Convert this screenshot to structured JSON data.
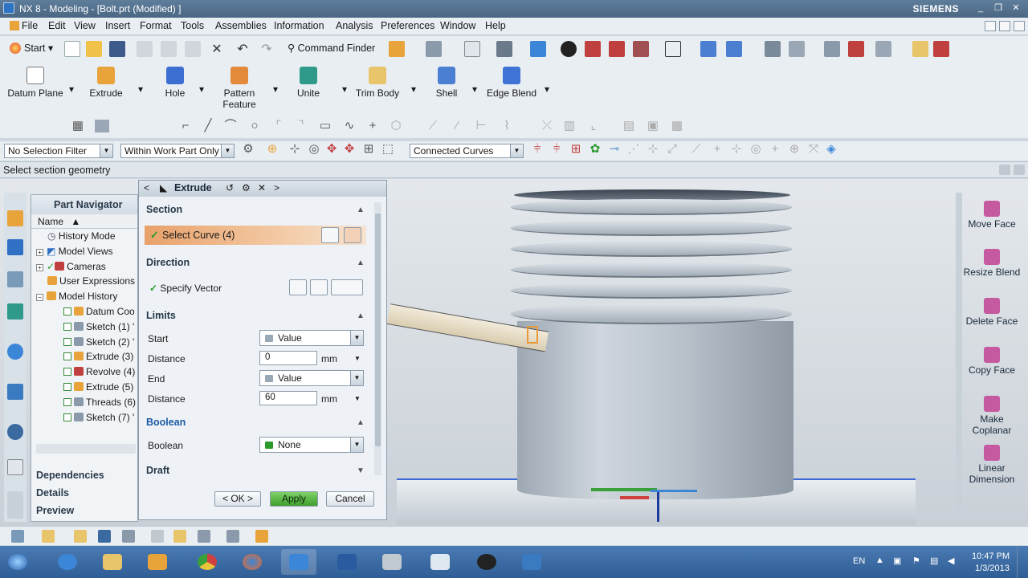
{
  "window": {
    "title": "NX 8 - Modeling - [Bolt.prt (Modified) ]",
    "brand": "SIEMENS"
  },
  "menu": [
    "File",
    "Edit",
    "View",
    "Insert",
    "Format",
    "Tools",
    "Assemblies",
    "Information",
    "Analysis",
    "Preferences",
    "Window",
    "Help"
  ],
  "toolbar": {
    "start_label": "Start",
    "command_finder_label": "Command Finder"
  },
  "ribbon": [
    {
      "label": "Datum Plane",
      "icon": "datum-plane-icon",
      "color": "#ffffff"
    },
    {
      "label": "Extrude",
      "icon": "extrude-icon",
      "color": "#e8a33a"
    },
    {
      "label": "Hole",
      "icon": "hole-icon",
      "color": "#3c6fd1"
    },
    {
      "label": "Pattern",
      "label2": "Feature",
      "icon": "pattern-feature-icon",
      "color": "#e38a3a"
    },
    {
      "label": "Unite",
      "icon": "unite-icon",
      "color": "#2f9a8a"
    },
    {
      "label": "Trim Body",
      "icon": "trim-body-icon",
      "color": "#e8c46a"
    },
    {
      "label": "Shell",
      "icon": "shell-icon",
      "color": "#4a7fd1"
    },
    {
      "label": "Edge Blend",
      "icon": "edge-blend-icon",
      "color": "#3f74d6"
    }
  ],
  "filters": {
    "selection_filter": "No Selection Filter",
    "scope": "Within Work Part Only",
    "curve_rule": "Connected Curves"
  },
  "cue_line": "Select section geometry",
  "part_navigator": {
    "title": "Part Navigator",
    "column": "Name",
    "items": [
      "History Mode",
      "Model Views",
      "Cameras",
      "User Expressions",
      "Model History",
      "Datum Coo",
      "Sketch (1) '",
      "Sketch (2) '",
      "Extrude (3)",
      "Revolve (4)",
      "Extrude (5)",
      "Threads (6)",
      "Sketch (7) '"
    ],
    "panels": [
      "Dependencies",
      "Details",
      "Preview"
    ]
  },
  "extrude_dialog": {
    "title": "Extrude",
    "section": {
      "header": "Section",
      "select_curve": "Select Curve (4)"
    },
    "direction": {
      "header": "Direction",
      "specify_vector": "Specify Vector"
    },
    "limits": {
      "header": "Limits",
      "start_label": "Start",
      "start_value": "Value",
      "start_distance_label": "Distance",
      "start_distance": "0",
      "end_label": "End",
      "end_value": "Value",
      "end_distance_label": "Distance",
      "end_distance": "60",
      "unit": "mm"
    },
    "boolean": {
      "header": "Boolean",
      "label": "Boolean",
      "value": "None"
    },
    "draft": {
      "header": "Draft"
    },
    "buttons": {
      "ok": "< OK >",
      "apply": "Apply",
      "cancel": "Cancel"
    }
  },
  "right_palette": [
    {
      "label": "Move Face",
      "icon": "move-face-icon"
    },
    {
      "label": "Resize Blend",
      "icon": "resize-blend-icon"
    },
    {
      "label": "Delete Face",
      "icon": "delete-face-icon"
    },
    {
      "label": "Copy Face",
      "icon": "copy-face-icon"
    },
    {
      "label": "Make",
      "label2": "Coplanar",
      "icon": "make-coplanar-icon"
    },
    {
      "label": "Linear",
      "label2": "Dimension",
      "icon": "linear-dimension-icon"
    }
  ],
  "taskbar": {
    "language": "EN",
    "time": "10:47 PM",
    "date": "1/3/2013"
  },
  "colors": {
    "accent": "#e8a16a",
    "selection_blue": "#3d67d6",
    "apply_green": "#3f9e2c"
  }
}
